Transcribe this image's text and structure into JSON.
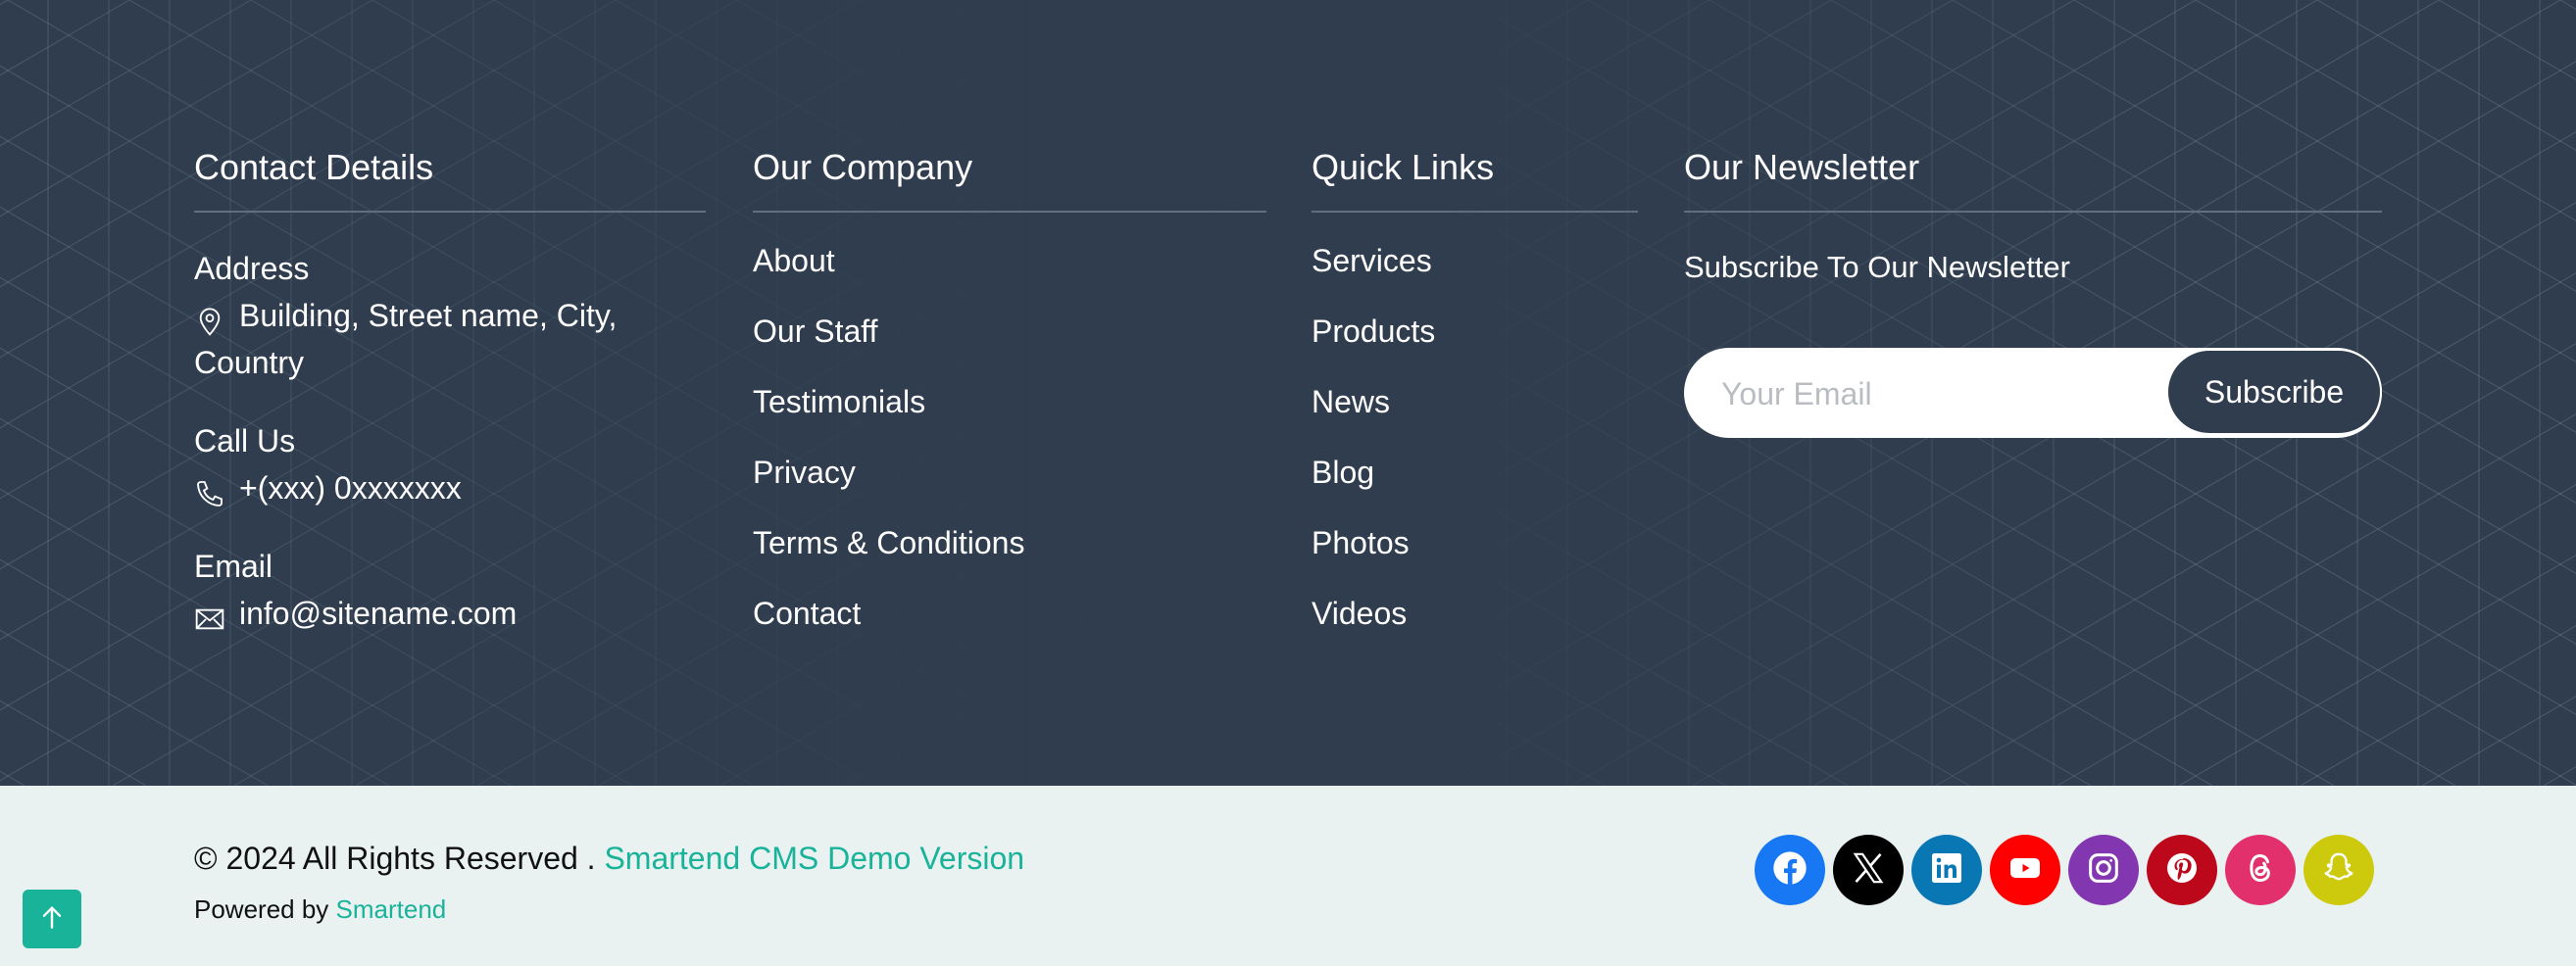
{
  "contact": {
    "title": "Contact Details",
    "address_label": "Address",
    "address_value": "Building, Street name, City, Country",
    "phone_label": "Call Us",
    "phone_value": "+(xxx) 0xxxxxxx",
    "email_label": "Email",
    "email_value": "info@sitename.com"
  },
  "company": {
    "title": "Our Company",
    "links": [
      "About",
      "Our Staff",
      "Testimonials",
      "Privacy",
      "Terms & Conditions",
      "Contact"
    ]
  },
  "quick_links": {
    "title": "Quick Links",
    "links": [
      "Services",
      "Products",
      "News",
      "Blog",
      "Photos",
      "Videos"
    ]
  },
  "newsletter": {
    "title": "Our Newsletter",
    "subtitle": "Subscribe To Our Newsletter",
    "email_placeholder": "Your Email",
    "email_value": "",
    "subscribe_label": "Subscribe"
  },
  "bottom": {
    "copyright_prefix": "© 2024 All Rights Reserved . ",
    "copyright_link": "Smartend CMS Demo Version",
    "powered_prefix": "Powered by ",
    "powered_link": "Smartend",
    "back_to_top_icon": "arrow-up-icon"
  },
  "socials": [
    {
      "name": "facebook",
      "icon": "facebook-icon",
      "color": "#1877f2"
    },
    {
      "name": "x",
      "icon": "x-icon",
      "color": "#000000"
    },
    {
      "name": "linkedin",
      "icon": "linkedin-icon",
      "color": "#0a77b5"
    },
    {
      "name": "youtube",
      "icon": "youtube-icon",
      "color": "#ff0000"
    },
    {
      "name": "instagram",
      "icon": "instagram-icon",
      "color": "#8236b0"
    },
    {
      "name": "pinterest",
      "icon": "pinterest-icon",
      "color": "#bd081c"
    },
    {
      "name": "threads",
      "icon": "threads-icon",
      "color": "#e1306c"
    },
    {
      "name": "snapchat",
      "icon": "snapchat-icon",
      "color": "#cdc90d"
    }
  ],
  "colors": {
    "footer_bg": "#2f3d4f",
    "bottom_bg": "#eaf1f1",
    "accent": "#19b39a"
  }
}
